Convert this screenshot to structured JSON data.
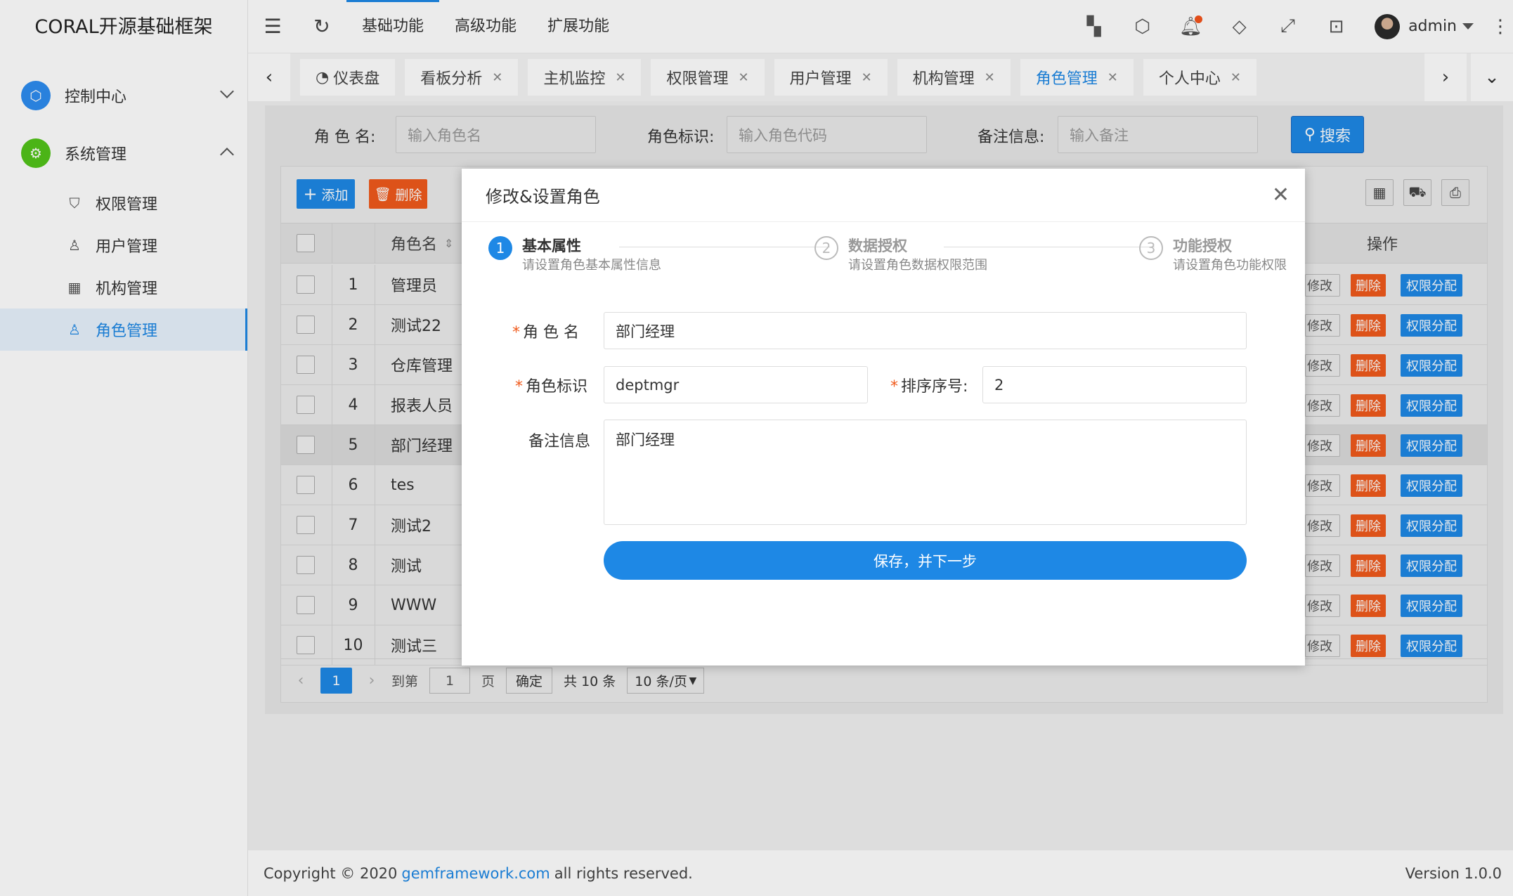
{
  "app": {
    "title": "CORAL开源基础框架"
  },
  "sidebar": {
    "groups": [
      {
        "label": "控制中心",
        "icon": "cube-icon",
        "color": "#1e88e5"
      },
      {
        "label": "系统管理",
        "icon": "gear-icon",
        "color": "#52c41a"
      }
    ],
    "items": [
      {
        "label": "权限管理",
        "icon": "shield-icon"
      },
      {
        "label": "用户管理",
        "icon": "user-icon"
      },
      {
        "label": "机构管理",
        "icon": "calendar-icon"
      },
      {
        "label": "角色管理",
        "icon": "user-icon",
        "active": true
      }
    ]
  },
  "topbar": {
    "menus": [
      "基础功能",
      "高级功能",
      "扩展功能"
    ],
    "user": "admin"
  },
  "tabs": [
    {
      "label": "仪表盘",
      "active": false
    },
    {
      "label": "看板分析"
    },
    {
      "label": "主机监控"
    },
    {
      "label": "权限管理"
    },
    {
      "label": "用户管理"
    },
    {
      "label": "机构管理"
    },
    {
      "label": "角色管理",
      "active": true
    },
    {
      "label": "个人中心"
    }
  ],
  "search": {
    "role_name_label": "角 色 名:",
    "role_name_placeholder": "输入角色名",
    "role_code_label": "角色标识:",
    "role_code_placeholder": "输入角色代码",
    "remark_label": "备注信息:",
    "remark_placeholder": "输入备注",
    "search_button": "搜索"
  },
  "toolbar": {
    "add": "添加",
    "delete": "删除"
  },
  "table": {
    "columns": {
      "name": "角色名",
      "ops": "操作"
    },
    "rows": [
      {
        "idx": "1",
        "name": "管理员"
      },
      {
        "idx": "2",
        "name": "测试22"
      },
      {
        "idx": "3",
        "name": "仓库管理"
      },
      {
        "idx": "4",
        "name": "报表人员"
      },
      {
        "idx": "5",
        "name": "部门经理"
      },
      {
        "idx": "6",
        "name": "tes"
      },
      {
        "idx": "7",
        "name": "测试2"
      },
      {
        "idx": "8",
        "name": "测试"
      },
      {
        "idx": "9",
        "name": "WWW"
      },
      {
        "idx": "10",
        "name": "测试三"
      }
    ],
    "op_edit": "修改",
    "op_delete": "删除",
    "op_perm": "权限分配"
  },
  "pager": {
    "current": "1",
    "goto_label": "到第",
    "goto_value": "1",
    "page_label": "页",
    "confirm": "确定",
    "total": "共 10 条",
    "page_size": "10 条/页"
  },
  "modal": {
    "title": "修改&设置角色",
    "steps": [
      {
        "num": "1",
        "title": "基本属性",
        "desc": "请设置角色基本属性信息"
      },
      {
        "num": "2",
        "title": "数据授权",
        "desc": "请设置角色数据权限范围"
      },
      {
        "num": "3",
        "title": "功能授权",
        "desc": "请设置角色功能权限"
      }
    ],
    "fields": {
      "role_name_label": "角 色 名",
      "role_name_value": "部门经理",
      "role_code_label": "角色标识",
      "role_code_value": "deptmgr",
      "sort_label": "排序序号:",
      "sort_value": "2",
      "remark_label": "备注信息",
      "remark_value": "部门经理"
    },
    "save_button": "保存，并下一步"
  },
  "footer": {
    "copyright_prefix": "Copyright © 2020",
    "link": "gemframework.com",
    "copyright_suffix": "all rights reserved.",
    "version": "Version 1.0.0"
  }
}
